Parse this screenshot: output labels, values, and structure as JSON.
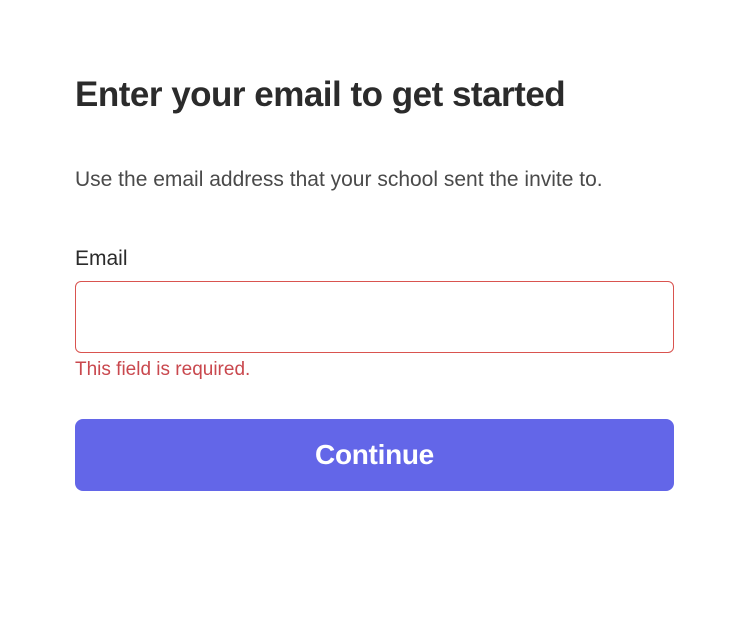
{
  "heading": "Enter your email to get started",
  "description": "Use the email address that your school sent the invite to.",
  "form": {
    "email": {
      "label": "Email",
      "value": "",
      "error": "This field is required."
    },
    "submit_label": "Continue"
  },
  "colors": {
    "primary": "#6366e8",
    "error": "#c9484e",
    "text_dark": "#2b2b2b",
    "text_muted": "#4a4a4a"
  }
}
